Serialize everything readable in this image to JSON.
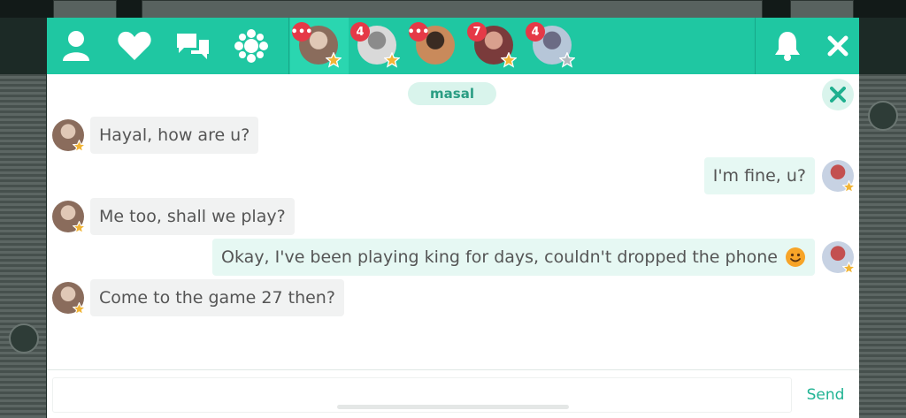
{
  "colors": {
    "accent": "#1fc7a2",
    "badge": "#e53947",
    "star_gold": "#f1b435",
    "star_grey": "#b4bac0"
  },
  "topbar": {
    "icons": [
      "user-icon",
      "heart-icon",
      "chat-icon",
      "puzzle-icon"
    ],
    "conversations": [
      {
        "name": "masal",
        "badge": "•••",
        "star": "gold",
        "active": true,
        "palette": [
          "#8a6c5c",
          "#e0c8b6"
        ]
      },
      {
        "name": "",
        "badge": "4",
        "star": "gold",
        "active": false,
        "palette": [
          "#d9d9d9",
          "#8b8b8b"
        ]
      },
      {
        "name": "",
        "badge": "•••",
        "star": "",
        "active": false,
        "palette": [
          "#c98a5b",
          "#3a2b22"
        ]
      },
      {
        "name": "",
        "badge": "7",
        "star": "gold",
        "active": false,
        "palette": [
          "#7a3b3b",
          "#d9a08e"
        ]
      },
      {
        "name": "",
        "badge": "4",
        "star": "grey",
        "active": false,
        "palette": [
          "#b6c6d8",
          "#6b6b84"
        ]
      }
    ],
    "bell_icon": "bell-icon",
    "close_icon": "close-icon"
  },
  "chat": {
    "partner_name": "masal",
    "messages": [
      {
        "dir": "in",
        "text": "Hayal, how are u?"
      },
      {
        "dir": "out",
        "text": "I'm fine, u?"
      },
      {
        "dir": "in",
        "text": "Me too, shall we play?"
      },
      {
        "dir": "out",
        "text": "Okay, I've been playing king for days, couldn't dropped the phone",
        "emoji": "smiley-icon"
      },
      {
        "dir": "in",
        "text": "Come to the game 27 then?"
      }
    ]
  },
  "composer": {
    "placeholder": "",
    "send_label": "Send"
  }
}
